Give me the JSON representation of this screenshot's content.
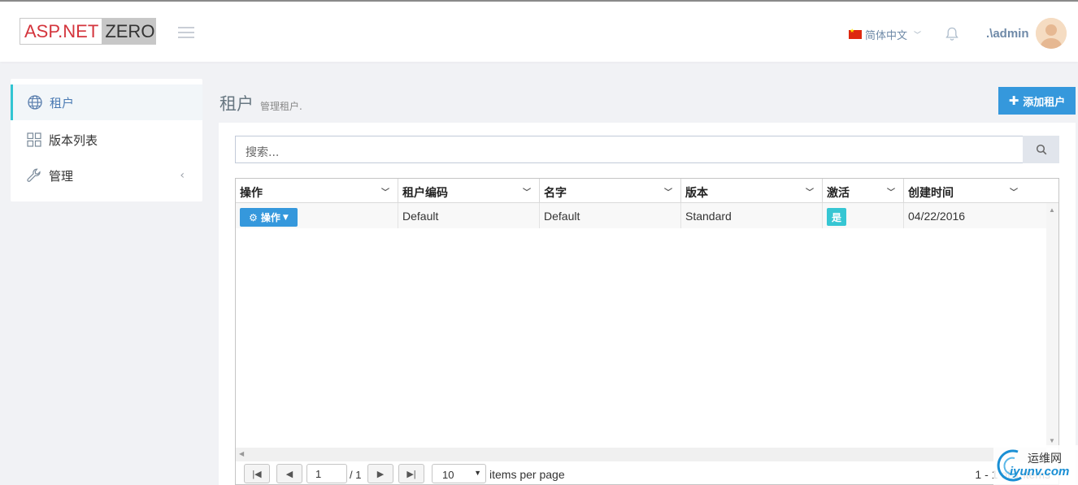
{
  "header": {
    "logo_left": "ASP.NET",
    "logo_right": "ZERO",
    "language": "简体中文",
    "user": ".\\admin"
  },
  "sidebar": {
    "items": [
      {
        "label": "租户",
        "icon": "globe-icon",
        "active": true
      },
      {
        "label": "版本列表",
        "icon": "grid-icon",
        "active": false
      },
      {
        "label": "管理",
        "icon": "wrench-icon",
        "active": false
      }
    ]
  },
  "page": {
    "title": "租户",
    "subtitle": "管理租户.",
    "add_button": "添加租户"
  },
  "search": {
    "placeholder": "搜索..."
  },
  "grid": {
    "columns": [
      "操作",
      "租户编码",
      "名字",
      "版本",
      "激活",
      "创建时间"
    ],
    "rows": [
      {
        "action": "操作",
        "tenancy_name": "Default",
        "name": "Default",
        "edition": "Standard",
        "active": "是",
        "created": "04/22/2016"
      }
    ]
  },
  "pager": {
    "page": "1",
    "of": "/ 1",
    "page_size": "10",
    "items_per_page": "items per page",
    "info": "1 - 1 of 1 items"
  },
  "watermark": {
    "cn": "运维网",
    "en": "iyunv.com"
  },
  "colors": {
    "primary": "#3598dc",
    "active_badge": "#36c6d3",
    "logo_red": "#d4353d"
  }
}
